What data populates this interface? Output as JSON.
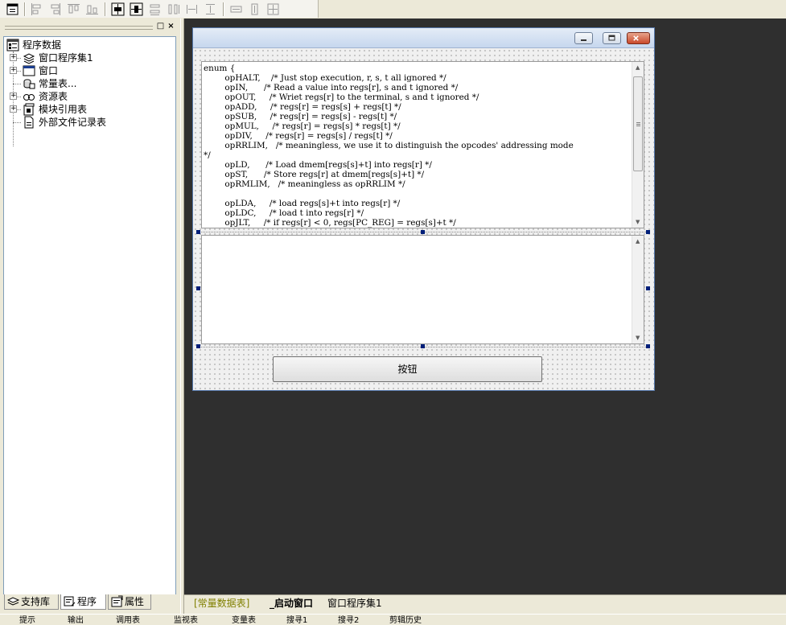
{
  "toolbar": {
    "buttons": [
      "form-icon",
      "align-left-icon",
      "align-right-icon",
      "align-top-icon",
      "align-bottom-icon",
      "center-horizontal-icon",
      "center-vertical-icon",
      "same-width-icon",
      "same-height-icon",
      "space-horizontal-icon",
      "space-vertical-icon",
      "stretch-width-icon",
      "stretch-height-icon",
      "grid-icon"
    ]
  },
  "tree": {
    "root": "程序数据",
    "items": [
      {
        "label": "窗口程序集1",
        "icon": "layers-icon",
        "expandable": true
      },
      {
        "label": "窗口",
        "icon": "window-icon",
        "expandable": true
      },
      {
        "label": "常量表...",
        "icon": "constants-icon",
        "expandable": false
      },
      {
        "label": "资源表",
        "icon": "resources-icon",
        "expandable": true
      },
      {
        "label": "模块引用表",
        "icon": "module-icon",
        "expandable": true
      },
      {
        "label": "外部文件记录表",
        "icon": "file-record-icon",
        "expandable": false
      }
    ]
  },
  "left_tabs": [
    {
      "label": "支持库",
      "icon": "library-icon"
    },
    {
      "label": "程序",
      "icon": "program-icon"
    },
    {
      "label": "属性",
      "icon": "properties-icon"
    }
  ],
  "form": {
    "code_text": "enum {\n        opHALT,    /* Just stop execution, r, s, t all ignored */\n        opIN,      /* Read a value into regs[r], s and t ignored */\n        opOUT,     /* Wriet regs[r] to the terminal, s and t ignored */\n        opADD,     /* regs[r] = regs[s] + regs[t] */\n        opSUB,     /* regs[r] = regs[s] - regs[t] */\n        opMUL,     /* regs[r] = regs[s] * regs[t] */\n        opDIV,     /* regs[r] = regs[s] / regs[t] */\n        opRRLIM,   /* meaningless, we use it to distinguish the opcodes' addressing mode\n*/\n        opLD,      /* Load dmem[regs[s]+t] into regs[r] */\n        opST,      /* Store regs[r] at dmem[regs[s]+t] */\n        opRMLIM,   /* meaningless as opRRLIM */\n\n        opLDA,     /* load regs[s]+t into regs[r] */\n        opLDC,     /* load t into regs[r] */\n        opJLT,     /* if regs[r] < 0, regs[PC_REG] = regs[s]+t */",
    "button_label": "按钮"
  },
  "doc_tabs": [
    {
      "label": "[常量数据表]",
      "state": "pending"
    },
    {
      "label": "_启动窗口",
      "state": "active"
    },
    {
      "label": "窗口程序集1",
      "state": "normal"
    }
  ],
  "status_bar": [
    "提示",
    "输出",
    "调用表",
    "监视表",
    "变量表",
    "搜寻1",
    "搜寻2",
    "剪辑历史"
  ]
}
